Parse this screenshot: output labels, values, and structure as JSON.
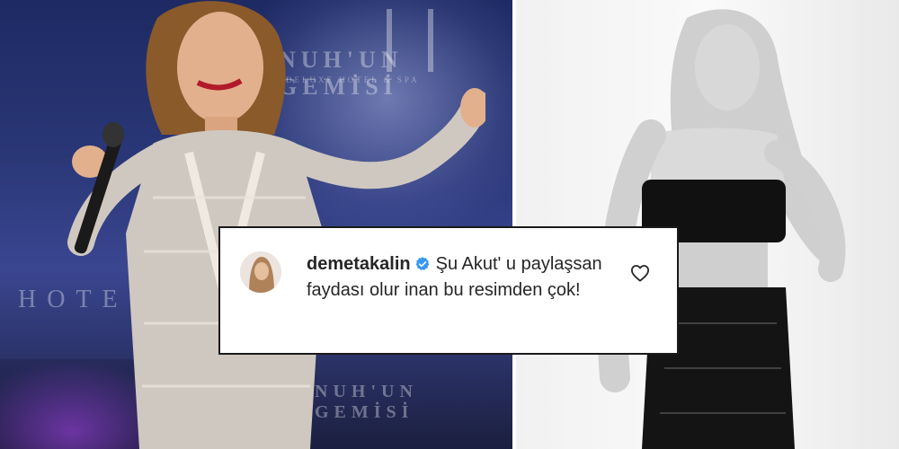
{
  "backdrop": {
    "brand_line": "NUH'UN GEMİSİ",
    "sub_line": "DELUXE HOTEL & SPA",
    "hotel_word": "HOTE",
    "bottom_brand": "NUH'UN GEMİSİ"
  },
  "comment": {
    "username": "demetakalin",
    "text": "Şu Akut' u paylaşsan faydası olur inan bu resimden çok!",
    "verified": true,
    "icons": {
      "verified": "verified-badge-icon",
      "like": "heart-icon"
    },
    "colors": {
      "verified": "#3897f0",
      "text": "#262626",
      "border": "#1a1a1a"
    }
  }
}
